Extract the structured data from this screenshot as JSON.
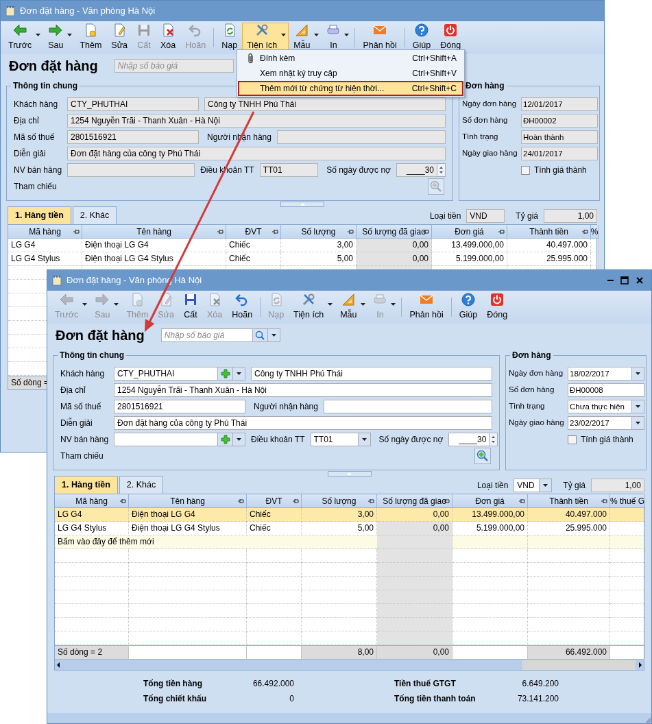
{
  "windows": [
    {
      "title": "Đơn đặt hàng - Văn phòng Hà Nội",
      "active": false,
      "editable": false,
      "toolbar": [
        {
          "kind": "button",
          "label": "Trước",
          "disabled": false,
          "dropdown": true,
          "open": false
        },
        {
          "kind": "button",
          "label": "Sau",
          "disabled": false,
          "dropdown": true,
          "open": false
        },
        {
          "kind": "button",
          "label": "Thêm",
          "disabled": false,
          "dropdown": false,
          "open": false
        },
        {
          "kind": "button",
          "label": "Sửa",
          "disabled": false,
          "dropdown": false,
          "open": false
        },
        {
          "kind": "button",
          "label": "Cất",
          "disabled": true,
          "dropdown": false,
          "open": false
        },
        {
          "kind": "button",
          "label": "Xóa",
          "disabled": false,
          "dropdown": false,
          "open": false
        },
        {
          "kind": "button",
          "label": "Hoãn",
          "disabled": true,
          "dropdown": false,
          "open": false
        },
        {
          "kind": "separator"
        },
        {
          "kind": "button",
          "label": "Nạp",
          "disabled": false,
          "dropdown": false,
          "open": false
        },
        {
          "kind": "button",
          "label": "Tiện ích",
          "disabled": false,
          "dropdown": true,
          "open": true
        },
        {
          "kind": "button",
          "label": "Mẫu",
          "disabled": false,
          "dropdown": true,
          "open": false
        },
        {
          "kind": "button",
          "label": "In",
          "disabled": false,
          "dropdown": true,
          "open": false
        },
        {
          "kind": "separator"
        },
        {
          "kind": "button",
          "label": "Phản hồi",
          "disabled": false,
          "dropdown": false,
          "open": false
        },
        {
          "kind": "separator"
        },
        {
          "kind": "button",
          "label": "Giúp",
          "disabled": false,
          "dropdown": false,
          "open": false
        },
        {
          "kind": "button",
          "label": "Đóng",
          "disabled": false,
          "dropdown": false,
          "open": false
        }
      ],
      "menu": [
        {
          "label": "Đính kèm",
          "shortcut": "Ctrl+Shift+A",
          "selected": false
        },
        {
          "label": "Xem nhật ký truy cập",
          "shortcut": "Ctrl+Shift+V",
          "selected": false
        },
        {
          "label": "Thêm mới từ chứng từ hiện thời...",
          "shortcut": "Ctrl+Shift+C",
          "selected": true
        }
      ],
      "heading": {
        "title": "Đơn đặt hàng",
        "placeholder": "Nhập số báo giá"
      },
      "general": {
        "title": "Thông tin chung",
        "customer": {
          "label": "Khách hàng",
          "code": "CTY_PHUTHAI",
          "name": "Công ty TNHH Phú Thái"
        },
        "address": {
          "label": "Địa chỉ",
          "value": "1254 Nguyễn Trãi - Thanh Xuân - Hà Nội"
        },
        "tax_code": {
          "label": "Mã số thuế",
          "value": "2801516921"
        },
        "receiver": {
          "label": "Người nhận hàng"
        },
        "description": {
          "label": "Diễn giải",
          "value": "Đơn đặt hàng của công ty Phú Thái"
        },
        "salesperson": {
          "label": "NV bán hàng"
        },
        "payment_terms": {
          "label": "Điều khoản TT",
          "value": "TT01"
        },
        "credit_days": {
          "label": "Số ngày được nợ",
          "value": "____30"
        },
        "reference": {
          "label": "Tham chiếu"
        }
      },
      "order": {
        "title": "Đơn hàng",
        "fields": [
          {
            "label": "Ngày đơn hàng",
            "value": "12/01/2017",
            "dropdown": false
          },
          {
            "label": "Số đơn hàng",
            "value": "ĐH00002",
            "dropdown": false
          },
          {
            "label": "Tình trạng",
            "value": "Hoàn thành",
            "dropdown": false
          },
          {
            "label": "Ngày giao hàng",
            "value": "24/01/2017",
            "dropdown": false
          }
        ],
        "cost_price": {
          "label": "Tính giá thành",
          "checked": false
        }
      },
      "tabs": [
        {
          "label": "1. Hàng tiền",
          "selected": true
        },
        {
          "label": "2. Khác",
          "selected": false
        }
      ],
      "currency": {
        "label": "Loại tiền",
        "value": "VND"
      },
      "rate": {
        "label": "Tỷ giá",
        "value": "1,00"
      },
      "grid": {
        "columns": [
          {
            "title": "Mã hàng"
          },
          {
            "title": "Tên hàng"
          },
          {
            "title": "ĐVT"
          },
          {
            "title": "Số lượng"
          },
          {
            "title": "Số lượng đã giao"
          },
          {
            "title": "Đơn giá"
          },
          {
            "title": "Thành tiền"
          },
          {
            "title": "%"
          }
        ],
        "rows": [
          {
            "selected": false,
            "cells": [
              "LG G4",
              "Điện thoại LG G4",
              "Chiếc",
              "3,00",
              "0,00",
              "13.499.000,00",
              "40.497.000"
            ]
          },
          {
            "selected": false,
            "cells": [
              "LG G4 Stylus",
              "Điện thoại LG G4 Stylus",
              "Chiếc",
              "5,00",
              "0,00",
              "5.199.000,00",
              "25.995.000"
            ]
          }
        ],
        "footer": {
          "row_count": "Số dòng ="
        }
      }
    },
    {
      "title": "Đơn đặt hàng - Văn phòng Hà Nội",
      "active": true,
      "editable": true,
      "toolbar": [
        {
          "kind": "button",
          "label": "Trước",
          "disabled": true,
          "dropdown": true,
          "open": false
        },
        {
          "kind": "button",
          "label": "Sau",
          "disabled": true,
          "dropdown": true,
          "open": false
        },
        {
          "kind": "button",
          "label": "Thêm",
          "disabled": true,
          "dropdown": false,
          "open": false
        },
        {
          "kind": "button",
          "label": "Sửa",
          "disabled": true,
          "dropdown": false,
          "open": false
        },
        {
          "kind": "button",
          "label": "Cất",
          "disabled": false,
          "dropdown": false,
          "open": false
        },
        {
          "kind": "button",
          "label": "Xóa",
          "disabled": true,
          "dropdown": false,
          "open": false
        },
        {
          "kind": "button",
          "label": "Hoãn",
          "disabled": false,
          "dropdown": false,
          "open": false
        },
        {
          "kind": "separator"
        },
        {
          "kind": "button",
          "label": "Nạp",
          "disabled": true,
          "dropdown": false,
          "open": false
        },
        {
          "kind": "button",
          "label": "Tiện ích",
          "disabled": false,
          "dropdown": true,
          "open": false
        },
        {
          "kind": "button",
          "label": "Mẫu",
          "disabled": false,
          "dropdown": true,
          "open": false
        },
        {
          "kind": "button",
          "label": "In",
          "disabled": true,
          "dropdown": true,
          "open": false
        },
        {
          "kind": "separator"
        },
        {
          "kind": "button",
          "label": "Phản hồi",
          "disabled": false,
          "dropdown": false,
          "open": false
        },
        {
          "kind": "separator"
        },
        {
          "kind": "button",
          "label": "Giúp",
          "disabled": false,
          "dropdown": false,
          "open": false
        },
        {
          "kind": "button",
          "label": "Đóng",
          "disabled": false,
          "dropdown": false,
          "open": false
        }
      ],
      "heading": {
        "title": "Đơn đặt hàng",
        "placeholder": "Nhập số báo giá"
      },
      "general": {
        "title": "Thông tin chung",
        "customer": {
          "label": "Khách hàng",
          "code": "CTY_PHUTHAI",
          "name": "Công ty TNHH Phú Thái"
        },
        "address": {
          "label": "Địa chỉ",
          "value": "1254 Nguyễn Trãi - Thanh Xuân - Hà Nội"
        },
        "tax_code": {
          "label": "Mã số thuế",
          "value": "2801516921"
        },
        "receiver": {
          "label": "Người nhận hàng"
        },
        "description": {
          "label": "Diễn giải",
          "value": "Đơn đặt hàng của công ty Phú Thái"
        },
        "salesperson": {
          "label": "NV bán hàng"
        },
        "payment_terms": {
          "label": "Điều khoản TT",
          "value": "TT01"
        },
        "credit_days": {
          "label": "Số ngày được nợ",
          "value": "____30"
        },
        "reference": {
          "label": "Tham chiếu"
        }
      },
      "order": {
        "title": "Đơn hàng",
        "fields": [
          {
            "label": "Ngày đơn hàng",
            "value": "18/02/2017",
            "dropdown": true
          },
          {
            "label": "Số đơn hàng",
            "value": "ĐH00008",
            "dropdown": false
          },
          {
            "label": "Tình trạng",
            "value": "Chưa thực hiện",
            "dropdown": true
          },
          {
            "label": "Ngày giao hàng",
            "value": "23/02/2017",
            "dropdown": true
          }
        ],
        "cost_price": {
          "label": "Tính giá thành",
          "checked": false
        }
      },
      "tabs": [
        {
          "label": "1. Hàng tiền",
          "selected": true
        },
        {
          "label": "2. Khác",
          "selected": false
        }
      ],
      "currency": {
        "label": "Loại tiền",
        "value": "VND"
      },
      "rate": {
        "label": "Tỷ giá",
        "value": "1,00"
      },
      "grid": {
        "columns": [
          {
            "title": "Mã hàng"
          },
          {
            "title": "Tên hàng"
          },
          {
            "title": "ĐVT"
          },
          {
            "title": "Số lượng"
          },
          {
            "title": "Số lượng đã giao"
          },
          {
            "title": "Đơn giá"
          },
          {
            "title": "Thành tiền"
          },
          {
            "title": "% thuế G"
          }
        ],
        "rows": [
          {
            "selected": true,
            "cells": [
              "LG G4",
              "Điện thoại LG G4",
              "Chiếc",
              "3,00",
              "0,00",
              "13.499.000,00",
              "40.497.000"
            ]
          },
          {
            "selected": false,
            "cells": [
              "LG G4 Stylus",
              "Điện thoại LG G4 Stylus",
              "Chiếc",
              "5,00",
              "0,00",
              "5.199.000,00",
              "25.995.000"
            ]
          }
        ],
        "new_row_hint": "Bấm vào đây để thêm mới",
        "footer": {
          "row_count": "Số dòng = 2",
          "quantity": "8,00",
          "delivered": "0,00",
          "amount": "66.492.000"
        }
      },
      "totals": [
        {
          "label": "Tổng tiền hàng",
          "value": "66.492.000"
        },
        {
          "label": "Tổng chiết khấu",
          "value": "0"
        },
        {
          "label": "Tiền thuế GTGT",
          "value": "6.649.200"
        },
        {
          "label": "Tổng tiền thanh toán",
          "value": "73.141.200"
        }
      ]
    }
  ]
}
